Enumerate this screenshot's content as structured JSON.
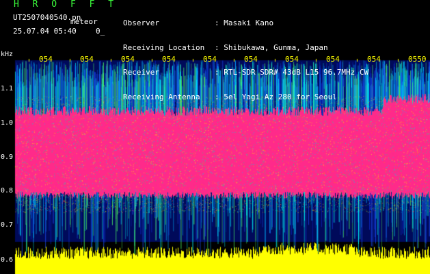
{
  "header": {
    "app_title": "H R O F F T",
    "file_name": "UT2507040540.pn",
    "file_suffix": "meteor",
    "date_time": "25.07.04 05:40",
    "channel": "0_"
  },
  "info": [
    {
      "label": "Observer",
      "value": ": Masaki Kano"
    },
    {
      "label": "Receiving Location",
      "value": ": Shibukawa, Gunma, Japan"
    },
    {
      "label": "Receiver",
      "value": ": RTL-SDR SDR# 43dB L15 96.7MHz CW"
    },
    {
      "label": "Receiving Antenna",
      "value": ": 5el Yagi Az 280 for Seoul"
    }
  ],
  "axis": {
    "y_unit": "kHz",
    "y_ticks": [
      "1.1",
      "1.0",
      "0.9",
      "0.8",
      "0.7",
      "0.6"
    ],
    "x_ticks": [
      "054",
      "054",
      "054",
      "054",
      "054",
      "054",
      "054",
      "054",
      "054",
      "0550"
    ]
  },
  "colors": {
    "background": "#000000",
    "strong_signal": "#ff2a8a",
    "floor_signal": "#ffff00",
    "header_green": "#3cff3c"
  }
}
